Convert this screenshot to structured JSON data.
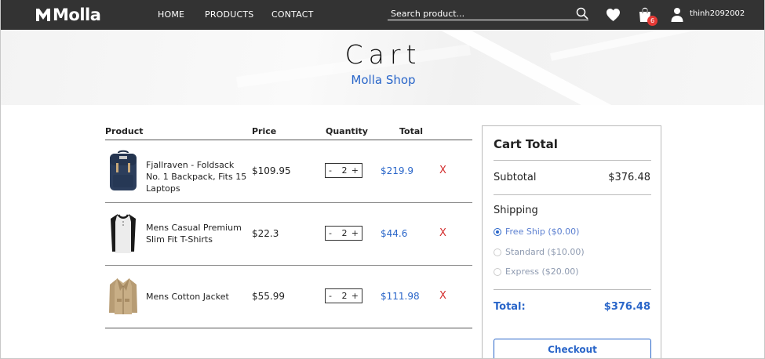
{
  "header": {
    "brand": "Molla",
    "nav": [
      "HOME",
      "PRODUCTS",
      "CONTACT"
    ],
    "search_placeholder": "Search product...",
    "cart_count": "6",
    "username": "thinh2092002",
    "icons": [
      "search-icon",
      "heart-icon",
      "shopping-bag-icon",
      "user-icon"
    ]
  },
  "hero": {
    "title": "Cart",
    "subtitle": "Molla Shop"
  },
  "table": {
    "headers": [
      "Product",
      "Price",
      "Quantity",
      "Total"
    ],
    "rows": [
      {
        "name": "Fjallraven - Foldsack No. 1 Backpack, Fits 15 Laptops",
        "price": "$109.95",
        "quantity": "2",
        "total": "$219.9",
        "remove": "X",
        "minus": "-",
        "plus": "+"
      },
      {
        "name": "Mens Casual Premium Slim Fit T-Shirts",
        "price": "$22.3",
        "quantity": "2",
        "total": "$44.6",
        "remove": "X",
        "minus": "-",
        "plus": "+"
      },
      {
        "name": "Mens Cotton Jacket",
        "price": "$55.99",
        "quantity": "2",
        "total": "$111.98",
        "remove": "X",
        "minus": "-",
        "plus": "+"
      }
    ]
  },
  "summary": {
    "title": "Cart Total",
    "subtotal_label": "Subtotal",
    "subtotal_value": "$376.48",
    "shipping_label": "Shipping",
    "options": [
      {
        "label": "Free Ship ($0.00)",
        "selected": true
      },
      {
        "label": "Standard ($10.00)",
        "selected": false
      },
      {
        "label": "Express ($20.00)",
        "selected": false
      }
    ],
    "total_label": "Total:",
    "total_value": "$376.48",
    "checkout_label": "Checkout"
  },
  "colors": {
    "header_bg": "#333333",
    "accent": "#2a66c9",
    "remove": "#d32f2f",
    "badge": "#e53935"
  }
}
